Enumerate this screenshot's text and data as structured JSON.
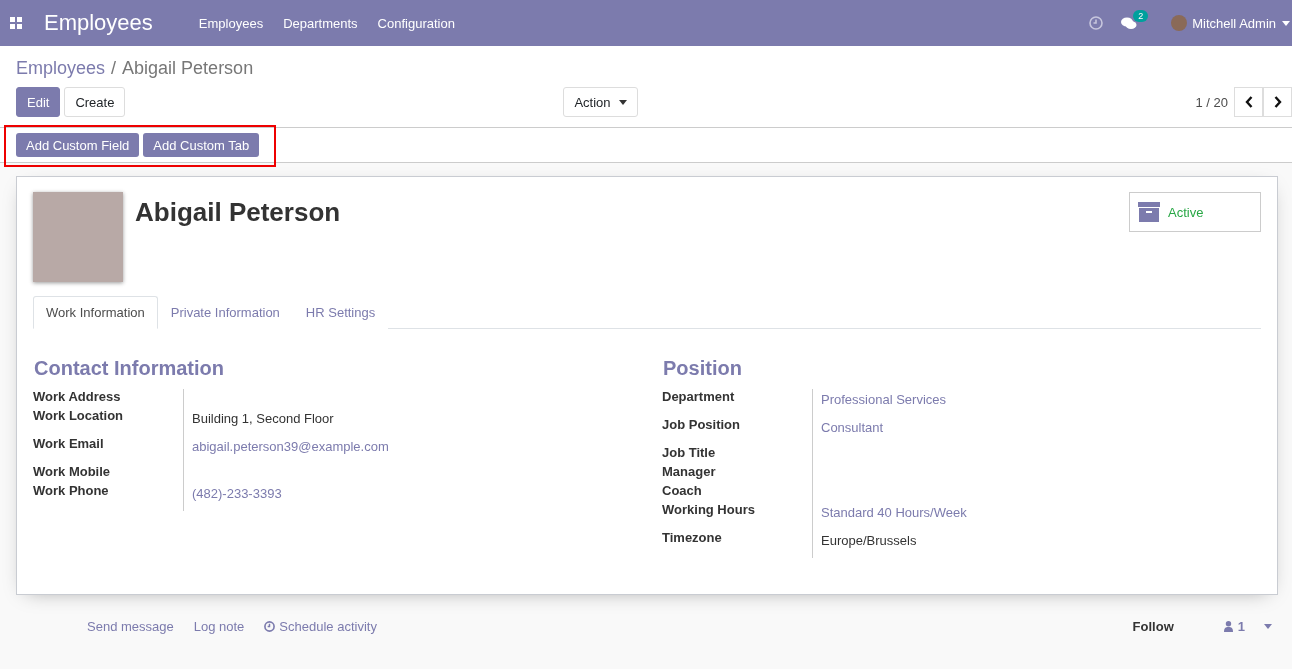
{
  "navbar": {
    "app_title": "Employees",
    "menu": [
      "Employees",
      "Departments",
      "Configuration"
    ],
    "messages_count": "2",
    "user": "Mitchell Admin"
  },
  "breadcrumb": {
    "parent": "Employees",
    "separator": "/",
    "current": "Abigail Peterson"
  },
  "buttons": {
    "primary": "Edit",
    "secondary": "Create",
    "action": "Action"
  },
  "pager": "1 / 20",
  "custom_buttons": [
    "Add Custom Field",
    "Add Custom Tab"
  ],
  "employee": {
    "name": "Abigail Peterson",
    "status": "Active"
  },
  "tabs": [
    {
      "label": "Work Information",
      "selected": true
    },
    {
      "label": "Private Information",
      "selected": false
    },
    {
      "label": "HR Settings",
      "selected": false
    }
  ],
  "groups": [
    {
      "title": "Contact Information",
      "fields": [
        {
          "label": "Work Address"
        },
        {
          "label": "Work Location",
          "value": "Building 1, Second Floor",
          "kind": "text"
        },
        {
          "label": "Work Email",
          "value": "abigail.peterson39@example.com",
          "kind": "link"
        },
        {
          "label": "Work Mobile"
        },
        {
          "label": "Work Phone",
          "value": "(482)-233-3393",
          "kind": "link"
        }
      ]
    },
    {
      "title": "Position",
      "fields": [
        {
          "label": "Department",
          "value": "Professional Services",
          "kind": "link"
        },
        {
          "label": "Job Position",
          "value": "Consultant",
          "kind": "link"
        },
        {
          "label": "Job Title"
        },
        {
          "label": "Manager"
        },
        {
          "label": "Coach"
        },
        {
          "label": "Working Hours",
          "value": "Standard 40 Hours/Week",
          "kind": "link"
        },
        {
          "label": "Timezone",
          "value": "Europe/Brussels",
          "kind": "text"
        }
      ]
    }
  ],
  "chatter": {
    "actions": [
      "Send message",
      "Log note",
      "Schedule activity"
    ],
    "follow": "Follow",
    "followers": "1"
  }
}
